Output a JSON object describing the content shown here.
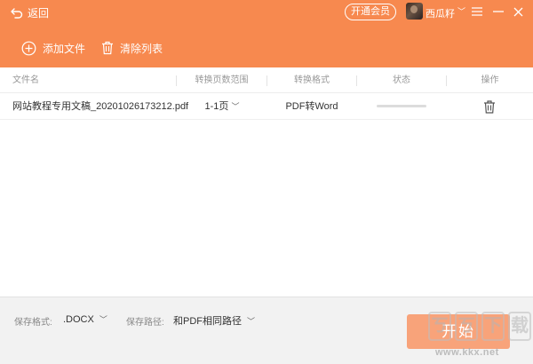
{
  "colors": {
    "accent": "#f7894f",
    "start_button": "#f8a37a",
    "footer_bg": "#f2f2f2"
  },
  "topbar": {
    "back_label": "返回",
    "vip_label": "开通会员",
    "username": "西瓜籽",
    "icons": [
      "back-arrow-icon",
      "user-chevron-icon",
      "menu-icon",
      "minimize-icon",
      "close-icon"
    ]
  },
  "toolbar": {
    "add_label": "添加文件",
    "clear_label": "清除列表",
    "icons": [
      "add-circle-icon",
      "trash-icon"
    ]
  },
  "table": {
    "headers": {
      "name": "文件名",
      "range": "转换页数范围",
      "format": "转换格式",
      "status": "状态",
      "action": "操作"
    },
    "rows": [
      {
        "name": "网站教程专用文稿_20201026173212.pdf",
        "range": "1-1页",
        "format": "PDF转Word",
        "progress": 0,
        "action_icon": "trash-icon"
      }
    ]
  },
  "footer": {
    "format_label": "保存格式:",
    "format_value": ".DOCX",
    "path_label": "保存路径:",
    "path_value": "和PDF相同路径",
    "start_label": "开始"
  },
  "watermark": {
    "chars": [
      "ㄎ",
      "ㄎ",
      "下",
      "载"
    ],
    "url": "www.kkx.net"
  }
}
